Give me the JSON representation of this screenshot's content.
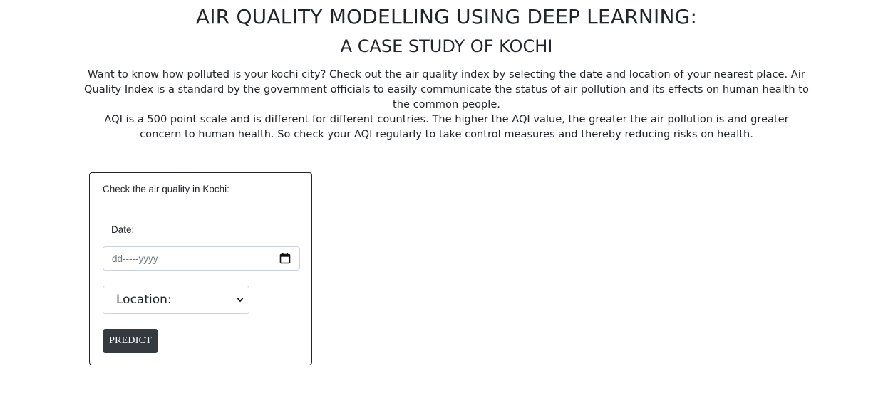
{
  "header": {
    "title": "AIR QUALITY MODELLING USING DEEP LEARNING:",
    "subtitle": "A CASE STUDY OF KOCHI"
  },
  "intro": {
    "paragraph1": "Want to know how polluted is your kochi city? Check out the air quality index by selecting the date and location of your nearest place. Air Quality Index is a standard by the government officials to easily communicate the status of air pollution and its effects on human health to the common people.",
    "paragraph2": "AQI is a 500 point scale and is different for different countries. The higher the AQI value, the greater the air pollution is and greater concern to human health. So check your AQI regularly to take control measures and thereby reducing risks on health."
  },
  "form": {
    "header": "Check the air quality in Kochi:",
    "date_label": "Date:",
    "date_placeholder": "dd-----yyyy",
    "date_icon": "calendar-icon",
    "location_selected": "Location:",
    "location_icon": "chevron-down-icon",
    "submit_label": "PREDICT"
  },
  "colors": {
    "text": "#212529",
    "button_bg": "#343a40",
    "button_text": "#ffffff",
    "input_border": "#ced4da",
    "placeholder": "#6c757d"
  }
}
